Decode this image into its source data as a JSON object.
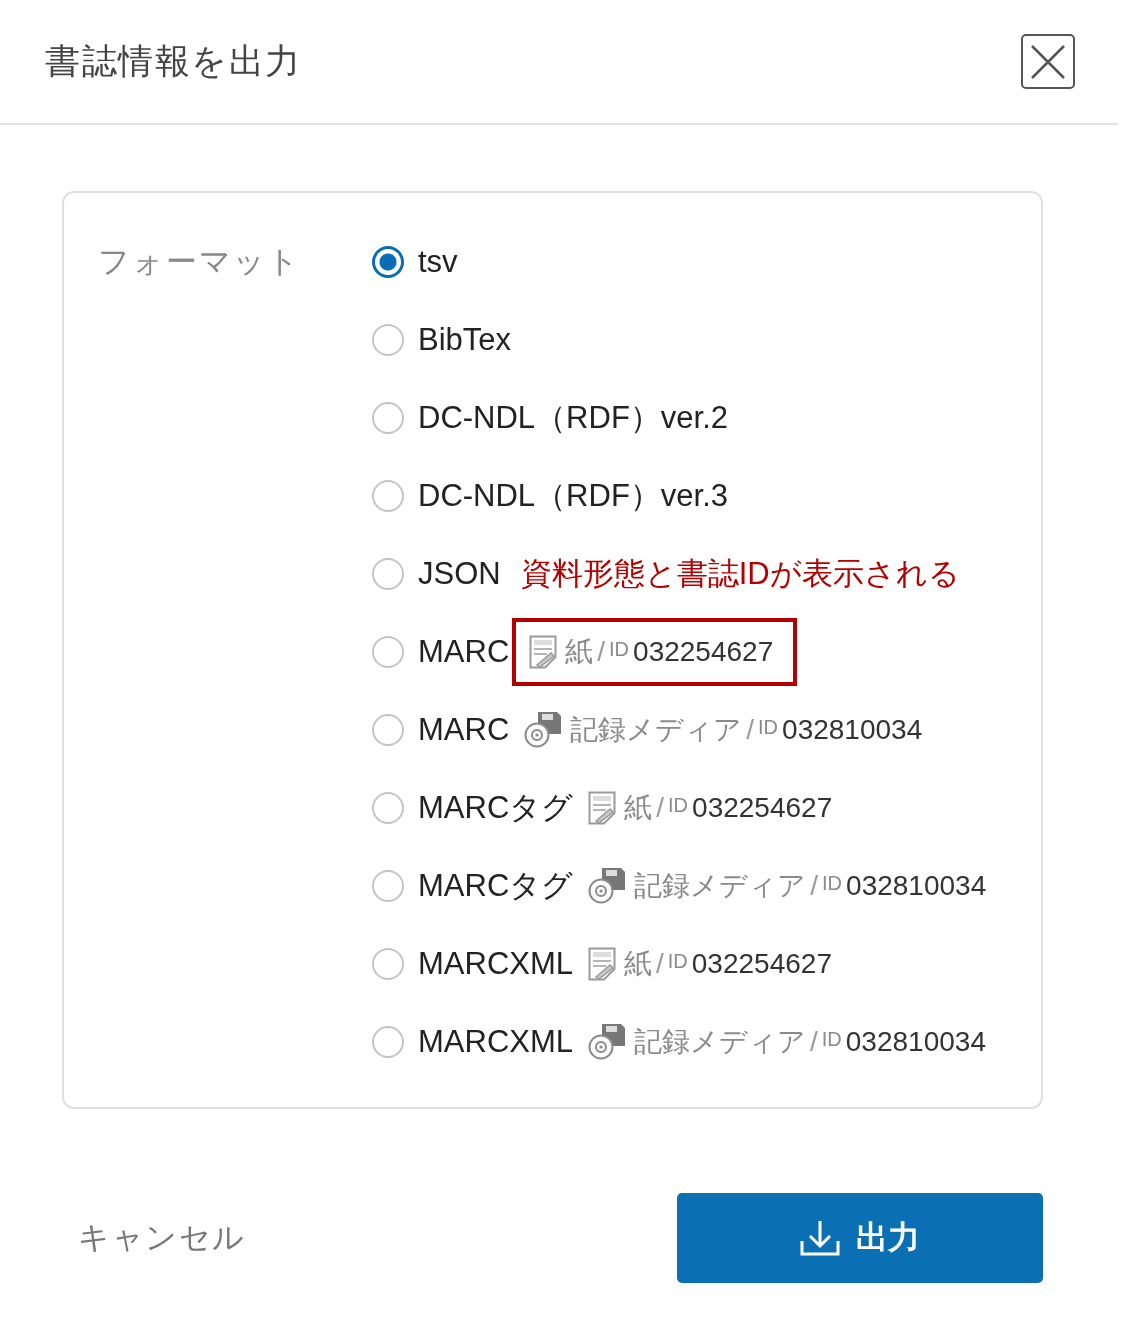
{
  "dialog": {
    "title": "書誌情報を出力"
  },
  "format": {
    "label": "フォーマット",
    "options": [
      {
        "label": "tsv",
        "selected": true
      },
      {
        "label": "BibTex",
        "selected": false
      },
      {
        "label": "DC-NDL（RDF）ver.2",
        "selected": false
      },
      {
        "label": "DC-NDL（RDF）ver.3",
        "selected": false
      },
      {
        "label": "JSON",
        "selected": false,
        "note": "資料形態と書誌IDが表示される"
      },
      {
        "label": "MARC",
        "selected": false,
        "material": {
          "kind": "paper",
          "type": "紙",
          "separator": "/",
          "id_label": "ID",
          "id": "032254627",
          "highlighted": true
        }
      },
      {
        "label": "MARC",
        "selected": false,
        "material": {
          "kind": "media",
          "type": "記録メディア",
          "separator": "/",
          "id_label": "ID",
          "id": "032810034",
          "highlighted": false
        }
      },
      {
        "label": "MARCタグ",
        "selected": false,
        "material": {
          "kind": "paper",
          "type": "紙",
          "separator": "/",
          "id_label": "ID",
          "id": "032254627",
          "highlighted": false
        }
      },
      {
        "label": "MARCタグ",
        "selected": false,
        "material": {
          "kind": "media",
          "type": "記録メディア",
          "separator": "/",
          "id_label": "ID",
          "id": "032810034",
          "highlighted": false
        }
      },
      {
        "label": "MARCXML",
        "selected": false,
        "material": {
          "kind": "paper",
          "type": "紙",
          "separator": "/",
          "id_label": "ID",
          "id": "032254627",
          "highlighted": false
        }
      },
      {
        "label": "MARCXML",
        "selected": false,
        "material": {
          "kind": "media",
          "type": "記録メディア",
          "separator": "/",
          "id_label": "ID",
          "id": "032810034",
          "highlighted": false
        }
      }
    ]
  },
  "footer": {
    "cancel": "キャンセル",
    "submit": "出力"
  }
}
